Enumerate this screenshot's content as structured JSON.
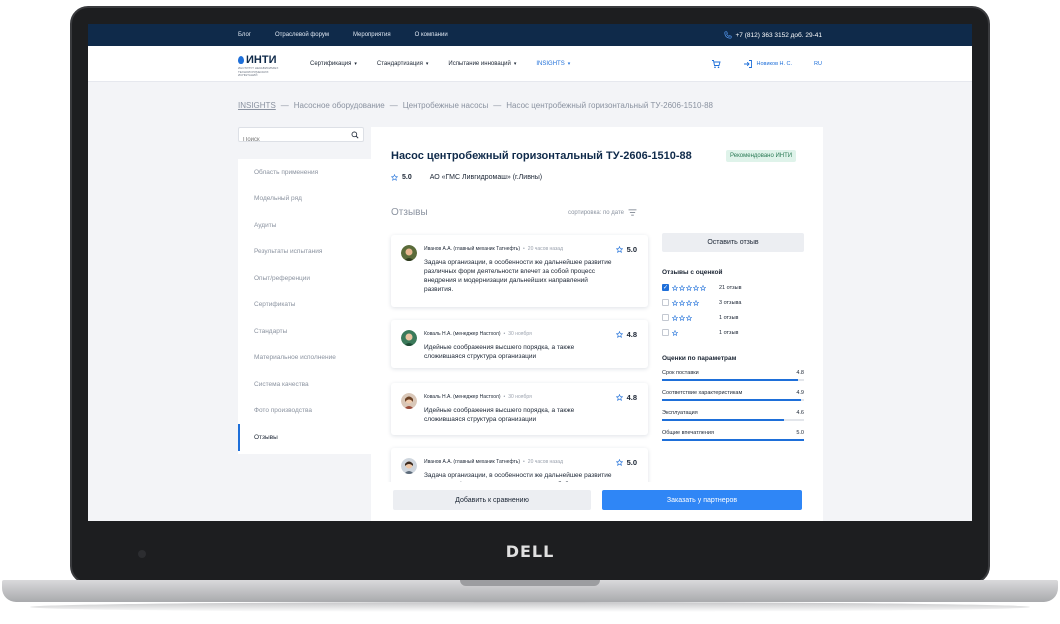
{
  "topbar": {
    "links": [
      "Блог",
      "Отраслевой форум",
      "Мероприятия",
      "О компании"
    ],
    "phone": "+7 (812) 363 3152 доб. 29-41"
  },
  "header": {
    "logo": "ИНТИ",
    "logo_sub": "ИНСТИТУТ НЕЗАВИСИМЫХ ТЕХНОЛОГИЧЕСКИХ ИСПЫТАНИЙ",
    "nav": [
      "Сертификация",
      "Стандартизация",
      "Испытание инноваций",
      "INSIGHTS"
    ],
    "user": "Новиков Н. С.",
    "lang": "RU"
  },
  "breadcrumb": [
    "INSIGHTS",
    "—",
    "Насосное оборудование",
    "—",
    "Центробежные насосы",
    "—",
    "Насос центробежный горизонтальный ТУ-2606-1510-88"
  ],
  "sidebar": {
    "search_placeholder": "Поиск",
    "items": [
      "Область применения",
      "Модельный ряд",
      "Аудиты",
      "Результаты испытания",
      "Опыт/референции",
      "Сертификаты",
      "Стандарты",
      "Материальное исполнение",
      "Система качества",
      "Фото производства",
      "Отзывы"
    ],
    "active_index": 10
  },
  "product": {
    "title": "Насос центробежный горизонтальный ТУ-2606-1510-88",
    "badge": "Рекомендовано ИНТИ",
    "rating": "5.0",
    "company": "АО «ГМС Ливгидромаш» (г.Ливны)"
  },
  "reviews": {
    "heading": "Отзывы",
    "sort_label": "сортировка: по дате",
    "items": [
      {
        "author": "Иванов А.А. (главный механик Татнефть)",
        "sep": "•",
        "ago": "20 часов назад",
        "score": "5.0",
        "text": "Задача организации, в особенности же дальнейшее развитие различных форм деятельности влечет за собой процесс внедрения и модернизации дальнейших направлений развития."
      },
      {
        "author": "Коваль Н.А. (менеджер Настхол)",
        "sep": "•",
        "ago": "30 ноября",
        "score": "4.8",
        "text": "Идейные соображения высшего порядка, а также сложившаяся структура организации"
      },
      {
        "author": "Коваль Н.А. (менеджер Настхол)",
        "sep": "•",
        "ago": "30 ноября",
        "score": "4.8",
        "text": "Идейные соображения высшего порядка, а также сложившаяся структура организации"
      },
      {
        "author": "Иванов А.А. (главный механик Татнефть)",
        "sep": "•",
        "ago": "20 часов назад",
        "score": "5.0",
        "text": "Задача организации, в особенности же дальнейшее развитие различных форм деятельности влечет за собой"
      }
    ]
  },
  "panel": {
    "leave_review": "Оставить отзыв",
    "filter_heading": "Отзывы с оценкой",
    "filters": [
      {
        "stars": 5,
        "label": "21 отзыв",
        "checked": true
      },
      {
        "stars": 4,
        "label": "3 отзыва",
        "checked": false
      },
      {
        "stars": 3,
        "label": "1 отзыв",
        "checked": false
      },
      {
        "stars": 1,
        "label": "1 отзыв",
        "checked": false
      }
    ],
    "params_heading": "Оценки по параметрам",
    "params": [
      {
        "label": "Срок поставки",
        "value": "4.8",
        "fraction": 0.96
      },
      {
        "label": "Соответствие характеристикам",
        "value": "4.9",
        "fraction": 0.98
      },
      {
        "label": "Эксплуатация",
        "value": "4.6",
        "fraction": 0.86
      },
      {
        "label": "Общие впечатления",
        "value": "5.0",
        "fraction": 1.0
      }
    ]
  },
  "actions": {
    "compare": "Добавить к сравнению",
    "order": "Заказать у партнеров"
  },
  "colors": {
    "topbar": "#0f2a4a",
    "accent": "#1e6fd9",
    "primary_button": "#2f86f6"
  },
  "icons": {
    "phone": "phone-icon",
    "cart": "cart-icon",
    "login": "login-icon",
    "search": "search-icon",
    "star": "star-outline-icon",
    "sort": "sort-icon"
  }
}
